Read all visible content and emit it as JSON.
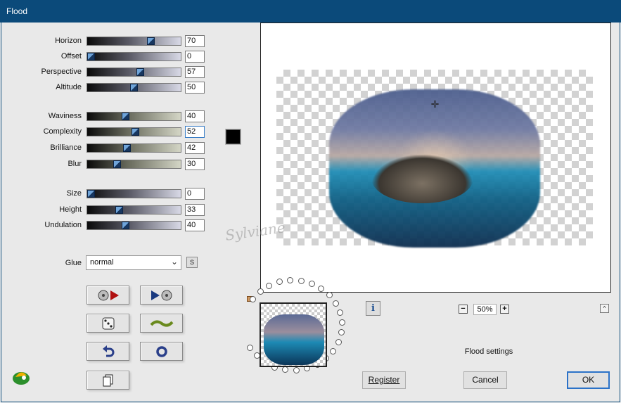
{
  "window": {
    "title": "Flood"
  },
  "sliders": [
    {
      "label": "Horizon",
      "value": "70",
      "level": 70
    },
    {
      "label": "Offset",
      "value": "0",
      "level": 0
    },
    {
      "label": "Perspective",
      "value": "57",
      "level": 57
    },
    {
      "label": "Altitude",
      "value": "50",
      "level": 50
    },
    {
      "label": "Waviness",
      "value": "40",
      "level": 40
    },
    {
      "label": "Complexity",
      "value": "52",
      "level": 52
    },
    {
      "label": "Brilliance",
      "value": "42",
      "level": 42
    },
    {
      "label": "Blur",
      "value": "30",
      "level": 30
    },
    {
      "label": "Size",
      "value": "0",
      "level": 0
    },
    {
      "label": "Height",
      "value": "33",
      "level": 33
    },
    {
      "label": "Undulation",
      "value": "40",
      "level": 40
    }
  ],
  "color_swatch": "#000000",
  "glue": {
    "label": "Glue",
    "selected": "normal",
    "s_button": "S"
  },
  "toolbar_icons": [
    "previous-preset-icon",
    "next-preset-icon",
    "random-dice-icon",
    "wave-icon",
    "undo-icon",
    "reset-circle-icon",
    "copy-icon"
  ],
  "preview": {
    "watermark": "Sylviane"
  },
  "zoom": {
    "minus": "−",
    "value": "50%",
    "plus": "+"
  },
  "info_button": "i",
  "collapse_button": "^",
  "status": "Flood settings",
  "buttons": {
    "register": "Register",
    "cancel": "Cancel",
    "ok": "OK"
  }
}
